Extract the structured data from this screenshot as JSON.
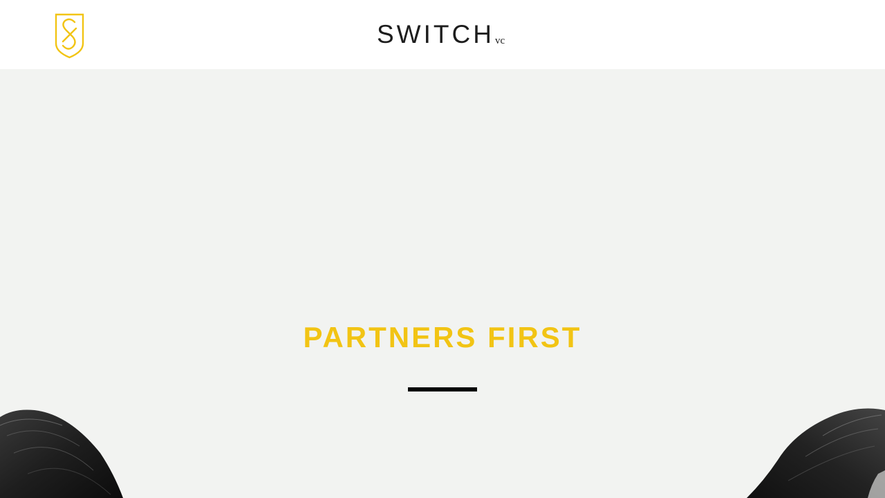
{
  "header": {
    "logo_icon": "switch-crest-logo-icon",
    "brand_name": "SWITCH",
    "brand_suffix": "vc"
  },
  "hero": {
    "title": "PARTNERS FIRST"
  },
  "images": {
    "left": "partner-portrait-left",
    "right": "partner-portrait-right"
  },
  "colors": {
    "accent": "#f2c414",
    "header_bg": "#ffffff",
    "page_bg": "#f2f3f1",
    "text_dark": "#1d1d1d",
    "rule": "#000000"
  }
}
